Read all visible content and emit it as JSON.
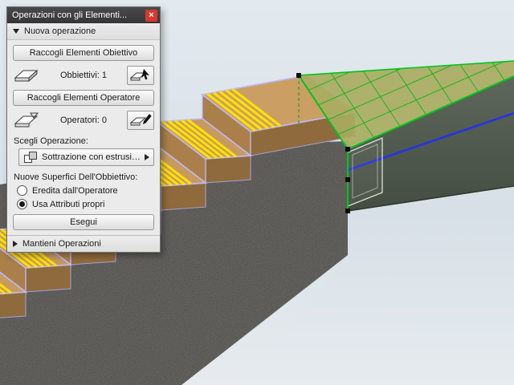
{
  "palette": {
    "title": "Operazioni con gli Elementi...",
    "close_glyph": "×",
    "sections": {
      "new_operation": "Nuova operazione",
      "keep_operations": "Mantieni Operazioni"
    },
    "buttons": {
      "collect_targets": "Raccogli Elementi Obiettivo",
      "collect_operators": "Raccogli Elementi Operatore",
      "execute": "Esegui"
    },
    "targets": {
      "label": "Obbiettivi:",
      "count": "1"
    },
    "operators": {
      "label": "Operatori:",
      "count": "0"
    },
    "choose_operation_label": "Scegli Operazione:",
    "operation_value": "Sottrazione con estrusio...",
    "new_surfaces_label": "Nuove Superfici Dell'Obbiettivo:",
    "radio_inherit": "Eredita dall'Operatore",
    "radio_own": "Usa Attributi propri",
    "radio_selected": "own"
  },
  "scene": {
    "selection_edge_color": "#00c41e",
    "operator_line_color": "#2334e6",
    "tread_stripe_color": "#ffe205",
    "selection_outline_color": "#beb8ee",
    "handle_color": "#0a0a0a",
    "wood_color": "#c79a5f",
    "concrete_color": "#4b4a47",
    "slab_top_color": "#a8ac61"
  }
}
